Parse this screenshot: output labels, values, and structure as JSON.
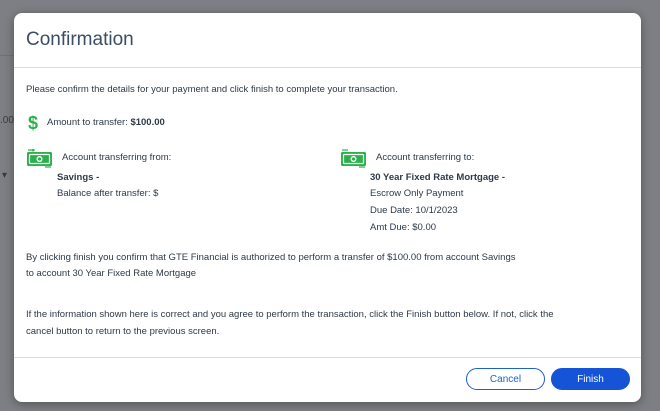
{
  "background": {
    "fragment_1": ".00",
    "fragment_2": "▾"
  },
  "dialog": {
    "title": "Confirmation",
    "intro": "Please confirm the details for your payment and click finish to complete your transaction.",
    "amount_label": "Amount to transfer:",
    "amount_value": "$100.00",
    "from": {
      "heading": "Account transferring from:",
      "account_name": "Savings -",
      "balance_line": "Balance after transfer: $"
    },
    "to": {
      "heading": "Account transferring to:",
      "account_name": "30 Year Fixed Rate Mortgage -",
      "line1": "Escrow Only Payment",
      "line2": "Due Date: 10/1/2023",
      "line3": "Amt Due: $0.00"
    },
    "authorization": {
      "line1": "By clicking finish you confirm that GTE Financial is authorized to perform a transfer of $100.00 from account Savings",
      "line2": "to account 30 Year Fixed Rate Mortgage"
    },
    "instructions": {
      "line1": "If the information shown here is correct and you agree to perform the transaction, click the Finish button below. If not, click the",
      "line2": "cancel button to return to the previous screen."
    },
    "buttons": {
      "cancel": "Cancel",
      "finish": "Finish"
    }
  },
  "colors": {
    "accent": "#1554d6",
    "icon_green": "#2bb14b",
    "title": "#3b4d63"
  },
  "icons": [
    "dollar-icon",
    "money-transfer-icon"
  ]
}
